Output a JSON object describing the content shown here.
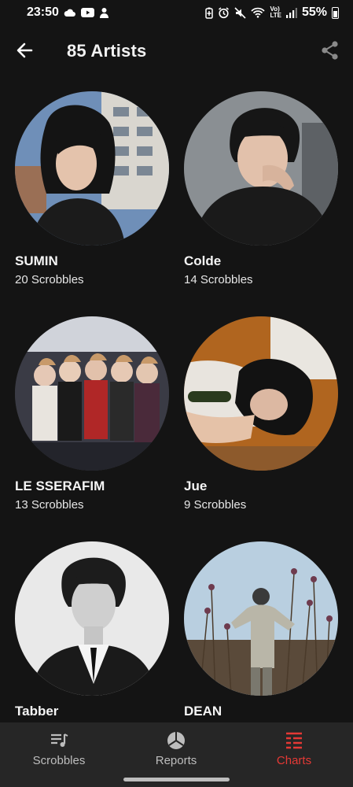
{
  "status_bar": {
    "time": "23:50",
    "battery": "55%",
    "left_icons": [
      "cloud-icon",
      "youtube-icon",
      "notification-icon"
    ],
    "right_icons": [
      "battery-saver-icon",
      "alarm-icon",
      "mute-icon",
      "wifi-icon",
      "volte-icon",
      "signal-icon",
      "battery-icon"
    ]
  },
  "app_bar": {
    "title": "85 Artists",
    "back_icon": "arrow-left-icon",
    "share_icon": "share-icon"
  },
  "artists": [
    {
      "name": "SUMIN",
      "count": "20 Scrobbles"
    },
    {
      "name": "Colde",
      "count": "14 Scrobbles"
    },
    {
      "name": "LE SSERAFIM",
      "count": "13 Scrobbles"
    },
    {
      "name": "Jue",
      "count": "9 Scrobbles"
    },
    {
      "name": "Tabber",
      "count": ""
    },
    {
      "name": "DEAN",
      "count": ""
    }
  ],
  "bottom_nav": {
    "items": [
      {
        "label": "Scrobbles",
        "icon": "music-list-icon",
        "active": false
      },
      {
        "label": "Reports",
        "icon": "pie-chart-icon",
        "active": false
      },
      {
        "label": "Charts",
        "icon": "chart-list-icon",
        "active": true
      }
    ]
  },
  "colors": {
    "background": "#141414",
    "nav_background": "#262626",
    "accent": "#e53935",
    "text": "#f2f2f2"
  }
}
